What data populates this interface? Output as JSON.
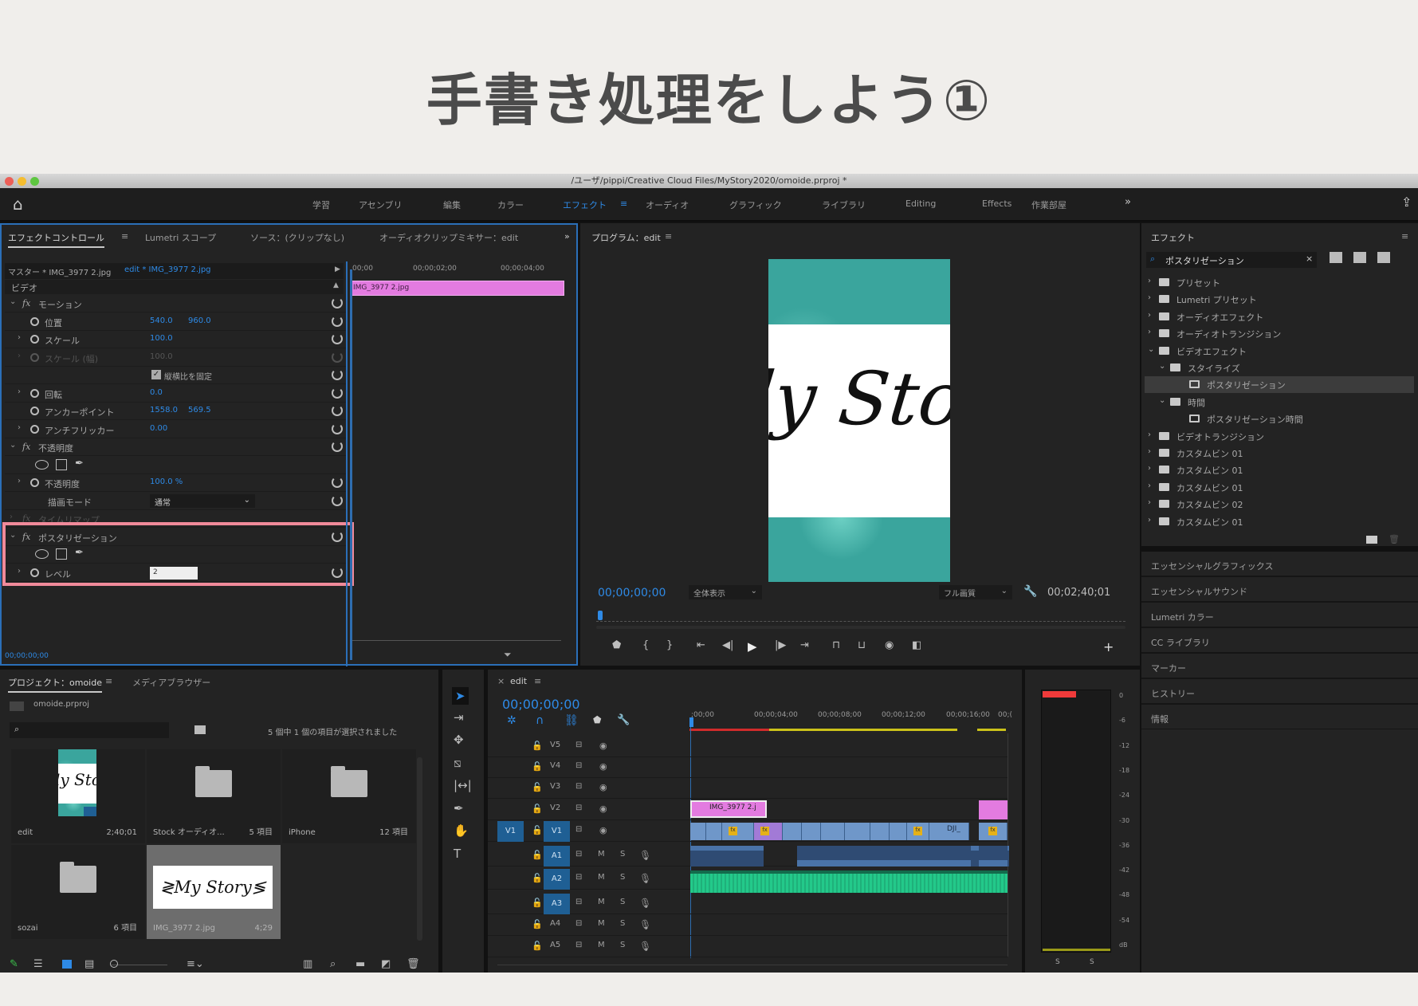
{
  "heading": "手書き処理をしよう①",
  "window_title": "/ユーザ/pippi/Creative Cloud Files/MyStory2020/omoide.prproj *",
  "nav": {
    "items": [
      "学習",
      "アセンブリ",
      "編集",
      "カラー",
      "エフェクト",
      "オーディオ",
      "グラフィック",
      "ライブラリ",
      "Editing",
      "Effects",
      "作業部屋"
    ],
    "active": "エフェクト",
    "more": "»"
  },
  "colors": {
    "accent": "#2e8ae6",
    "clip_pink": "#e37be0",
    "highlight": "#f08a9a",
    "audio_green": "#23c98a"
  },
  "effect_controls": {
    "tabs": [
      "エフェクトコントロール",
      "Lumetri スコープ",
      "ソース：(クリップなし)",
      "オーディオクリップミキサー：edit"
    ],
    "master": "マスター * IMG_3977 2.jpg",
    "sequence_clip": "edit * IMG_3977 2.jpg",
    "ruler": [
      "00;00",
      "00;00;02;00",
      "00;00;04;00"
    ],
    "clip_name": "IMG_3977 2.jpg",
    "section": "ビデオ",
    "rows": [
      {
        "type": "fx",
        "label": "モーション"
      },
      {
        "type": "prop",
        "label": "位置",
        "v1": "540.0",
        "v2": "960.0",
        "expand": false
      },
      {
        "type": "prop",
        "label": "スケール",
        "v1": "100.0",
        "expand": true
      },
      {
        "type": "prop",
        "label": "スケール (幅)",
        "v1": "100.0",
        "expand": true,
        "disabled": true
      },
      {
        "type": "check",
        "label": "縦横比を固定"
      },
      {
        "type": "prop",
        "label": "回転",
        "v1": "0.0",
        "expand": true
      },
      {
        "type": "prop",
        "label": "アンカーポイント",
        "v1": "1558.0",
        "v2": "569.5",
        "expand": false
      },
      {
        "type": "prop",
        "label": "アンチフリッカー",
        "v1": "0.00",
        "expand": true
      },
      {
        "type": "fx",
        "label": "不透明度"
      },
      {
        "type": "masks"
      },
      {
        "type": "prop",
        "label": "不透明度",
        "v1": "100.0 %",
        "expand": true
      },
      {
        "type": "select",
        "label": "描画モード",
        "v1": "通常"
      },
      {
        "type": "fx",
        "label": "タイムリマップ",
        "disabled": true
      },
      {
        "type": "fx",
        "label": "ポスタリゼーション"
      },
      {
        "type": "masks"
      },
      {
        "type": "input",
        "label": "レベル",
        "v1": "2",
        "expand": true
      }
    ],
    "timecode": "00;00;00;00"
  },
  "program": {
    "title": "プログラム：edit",
    "preview_text": "ly Stor",
    "timecode": "00;00;00;00",
    "zoom": "全体表示",
    "quality": "フル画質",
    "duration": "00;02;40;01",
    "controls": [
      "marker",
      "mark-in",
      "mark-out",
      "go-to-in",
      "step-back",
      "play",
      "step-forward",
      "go-to-out",
      "lift",
      "extract",
      "export-frame",
      "compare"
    ]
  },
  "effects_panel": {
    "title": "エフェクト",
    "search": "ポスタリゼーション",
    "tree": [
      {
        "label": "プリセット",
        "depth": 0,
        "kind": "preset",
        "open": false
      },
      {
        "label": "Lumetri プリセット",
        "depth": 0,
        "kind": "preset",
        "open": false
      },
      {
        "label": "オーディオエフェクト",
        "depth": 0,
        "kind": "folder",
        "open": false
      },
      {
        "label": "オーディオトランジション",
        "depth": 0,
        "kind": "folder",
        "open": false
      },
      {
        "label": "ビデオエフェクト",
        "depth": 0,
        "kind": "folder",
        "open": true
      },
      {
        "label": "スタイライズ",
        "depth": 1,
        "kind": "folder",
        "open": true
      },
      {
        "label": "ポスタリゼーション",
        "depth": 2,
        "kind": "effect",
        "selected": true
      },
      {
        "label": "時間",
        "depth": 1,
        "kind": "folder",
        "open": true
      },
      {
        "label": "ポスタリゼーション時間",
        "depth": 2,
        "kind": "effect"
      },
      {
        "label": "ビデオトランジション",
        "depth": 0,
        "kind": "folder",
        "open": false
      },
      {
        "label": "カスタムビン 01",
        "depth": 0,
        "kind": "folder",
        "open": false
      },
      {
        "label": "カスタムビン 01",
        "depth": 0,
        "kind": "folder",
        "open": false
      },
      {
        "label": "カスタムビン 01",
        "depth": 0,
        "kind": "folder",
        "open": false
      },
      {
        "label": "カスタムビン 02",
        "depth": 0,
        "kind": "folder",
        "open": false
      },
      {
        "label": "カスタムビン 01",
        "depth": 0,
        "kind": "folder",
        "open": false
      }
    ],
    "sections": [
      "エッセンシャルグラフィックス",
      "エッセンシャルサウンド",
      "Lumetri カラー",
      "CC ライブラリ",
      "マーカー",
      "ヒストリー",
      "情報"
    ]
  },
  "project": {
    "tabs": [
      "プロジェクト：omoide",
      "メディアブラウザー"
    ],
    "file": "omoide.prproj",
    "search_placeholder": "",
    "status": "5 個中 1 個の項目が選択されました",
    "items": [
      {
        "name": "edit",
        "count": "2;40;01",
        "kind": "sequence",
        "thumb": "ly Stor"
      },
      {
        "name": "Stock オーディオ...",
        "count": "5 項目",
        "kind": "folder"
      },
      {
        "name": "iPhone",
        "count": "12 項目",
        "kind": "folder"
      },
      {
        "name": "sozai",
        "count": "6 項目",
        "kind": "folder"
      },
      {
        "name": "IMG_3977 2.jpg",
        "count": "4;29",
        "kind": "image",
        "thumb": "≷My Story≶",
        "selected": true
      }
    ]
  },
  "timeline": {
    "tab": "edit",
    "timecode": "00;00;00;00",
    "ruler": [
      ";00;00",
      "00;00;04;00",
      "00;00;08;00",
      "00;00;12;00",
      "00;00;16;00",
      "00;("
    ],
    "video_tracks": [
      "V5",
      "V4",
      "V3",
      "V2",
      "V1"
    ],
    "audio_tracks": [
      "A1",
      "A2",
      "A3",
      "A4",
      "A5"
    ],
    "source_patch": "V1",
    "v2_clip": "IMG_3977 2.j",
    "v1_clip_label": "DJI_",
    "audio_labels": {
      "mute": "M",
      "solo": "S"
    }
  },
  "tools": [
    "selection",
    "track-select",
    "ripple-edit",
    "razor",
    "slip",
    "pen",
    "hand",
    "type"
  ],
  "audio_meter": {
    "scale": [
      "0",
      "-6",
      "-12",
      "-18",
      "-24",
      "-30",
      "-36",
      "-42",
      "-48",
      "-54",
      "dB"
    ],
    "solo": [
      "S",
      "S"
    ]
  }
}
